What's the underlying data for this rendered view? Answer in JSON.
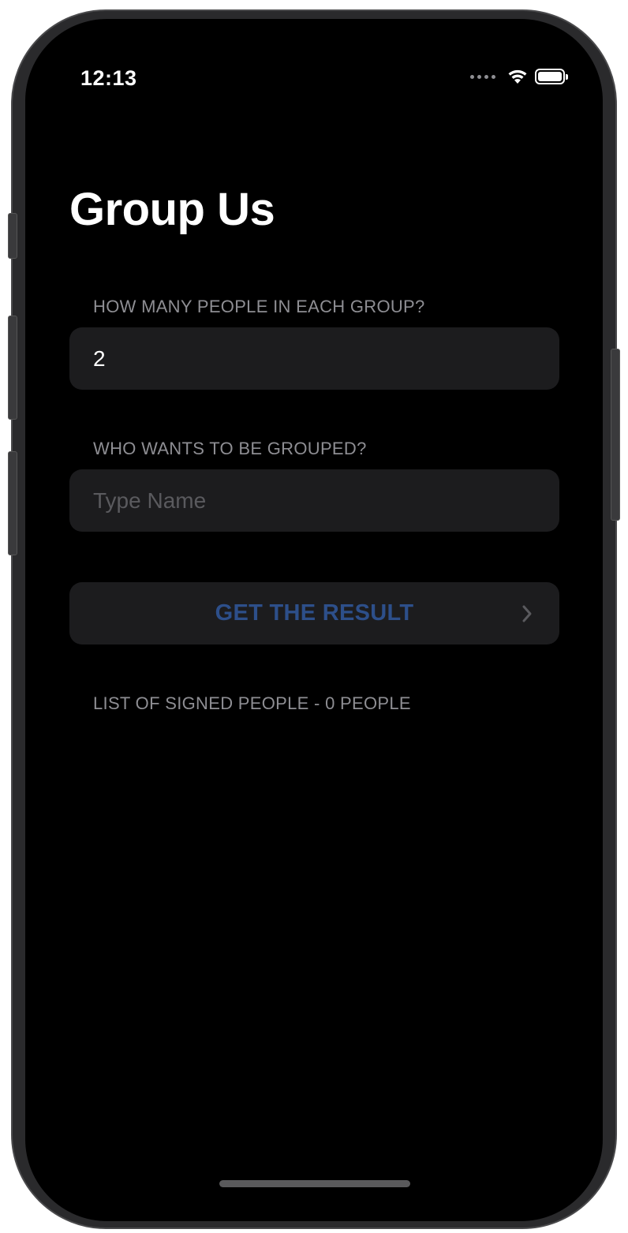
{
  "status_bar": {
    "time": "12:13"
  },
  "app": {
    "title": "Group Us"
  },
  "group_size_section": {
    "header": "HOW MANY PEOPLE IN EACH GROUP?",
    "value": "2"
  },
  "names_section": {
    "header": "WHO WANTS TO BE GROUPED?",
    "placeholder": "Type Name"
  },
  "result_button": {
    "label": "GET THE RESULT"
  },
  "list_section": {
    "header": "LIST OF SIGNED PEOPLE - 0 PEOPLE"
  },
  "colors": {
    "background": "#000000",
    "cell_background": "#1c1c1e",
    "secondary_text": "#8e8e93",
    "button_text": "#2d4f8a"
  },
  "icons": [
    "wifi-icon",
    "battery-icon",
    "chevron-right-icon"
  ]
}
